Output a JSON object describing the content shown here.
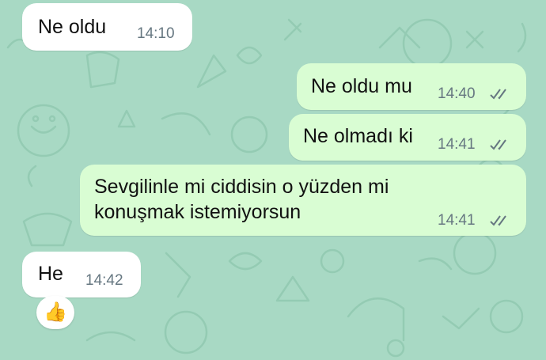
{
  "chat": {
    "messages": [
      {
        "direction": "incoming",
        "text": "Ne oldu",
        "time": "14:10"
      },
      {
        "direction": "outgoing",
        "text": "Ne oldu mu",
        "time": "14:40",
        "status": "read"
      },
      {
        "direction": "outgoing",
        "text": "Ne olmadı ki",
        "time": "14:41",
        "status": "read"
      },
      {
        "direction": "outgoing",
        "text_lines": [
          "Sevgilinle mi ciddisin o yüzden mi",
          "konuşmak istemiyorsun"
        ],
        "time": "14:41",
        "status": "read"
      },
      {
        "direction": "incoming",
        "text": "He",
        "time": "14:42",
        "reaction": "👍"
      }
    ]
  },
  "colors": {
    "wallpaper": "#a8d9c4",
    "incoming_bubble": "#ffffff",
    "outgoing_bubble": "#d9fdd3",
    "read_ticks": "#667781"
  },
  "icons": {
    "read_status": "double-check-icon"
  }
}
